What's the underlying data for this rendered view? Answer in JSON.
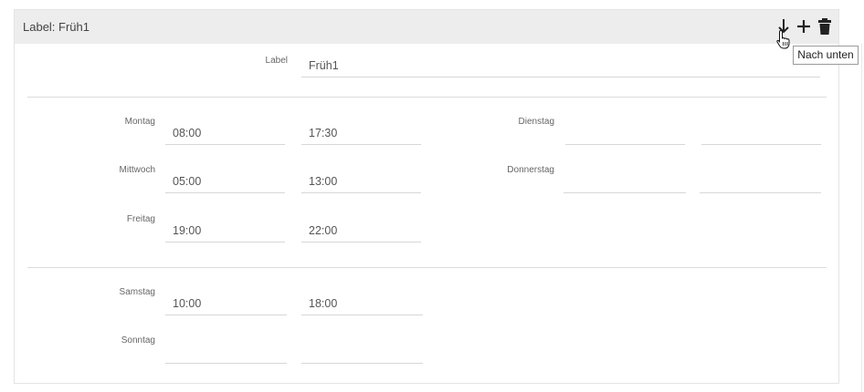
{
  "header": {
    "title": "Label: Früh1",
    "icons": [
      "arrow-down-icon",
      "plus-icon",
      "trash-icon"
    ]
  },
  "tooltip": {
    "text": "Nach unten"
  },
  "label_field": {
    "label": "Label",
    "value": "Früh1"
  },
  "days": {
    "montag": {
      "label": "Montag",
      "from": "08:00",
      "to": "17:30"
    },
    "dienstag": {
      "label": "Dienstag",
      "from": "",
      "to": ""
    },
    "mittwoch": {
      "label": "Mittwoch",
      "from": "05:00",
      "to": "13:00"
    },
    "donnerstag": {
      "label": "Donnerstag",
      "from": "",
      "to": ""
    },
    "freitag": {
      "label": "Freitag",
      "from": "19:00",
      "to": "22:00"
    },
    "samstag": {
      "label": "Samstag",
      "from": "10:00",
      "to": "18:00"
    },
    "sonntag": {
      "label": "Sonntag",
      "from": "",
      "to": ""
    }
  }
}
